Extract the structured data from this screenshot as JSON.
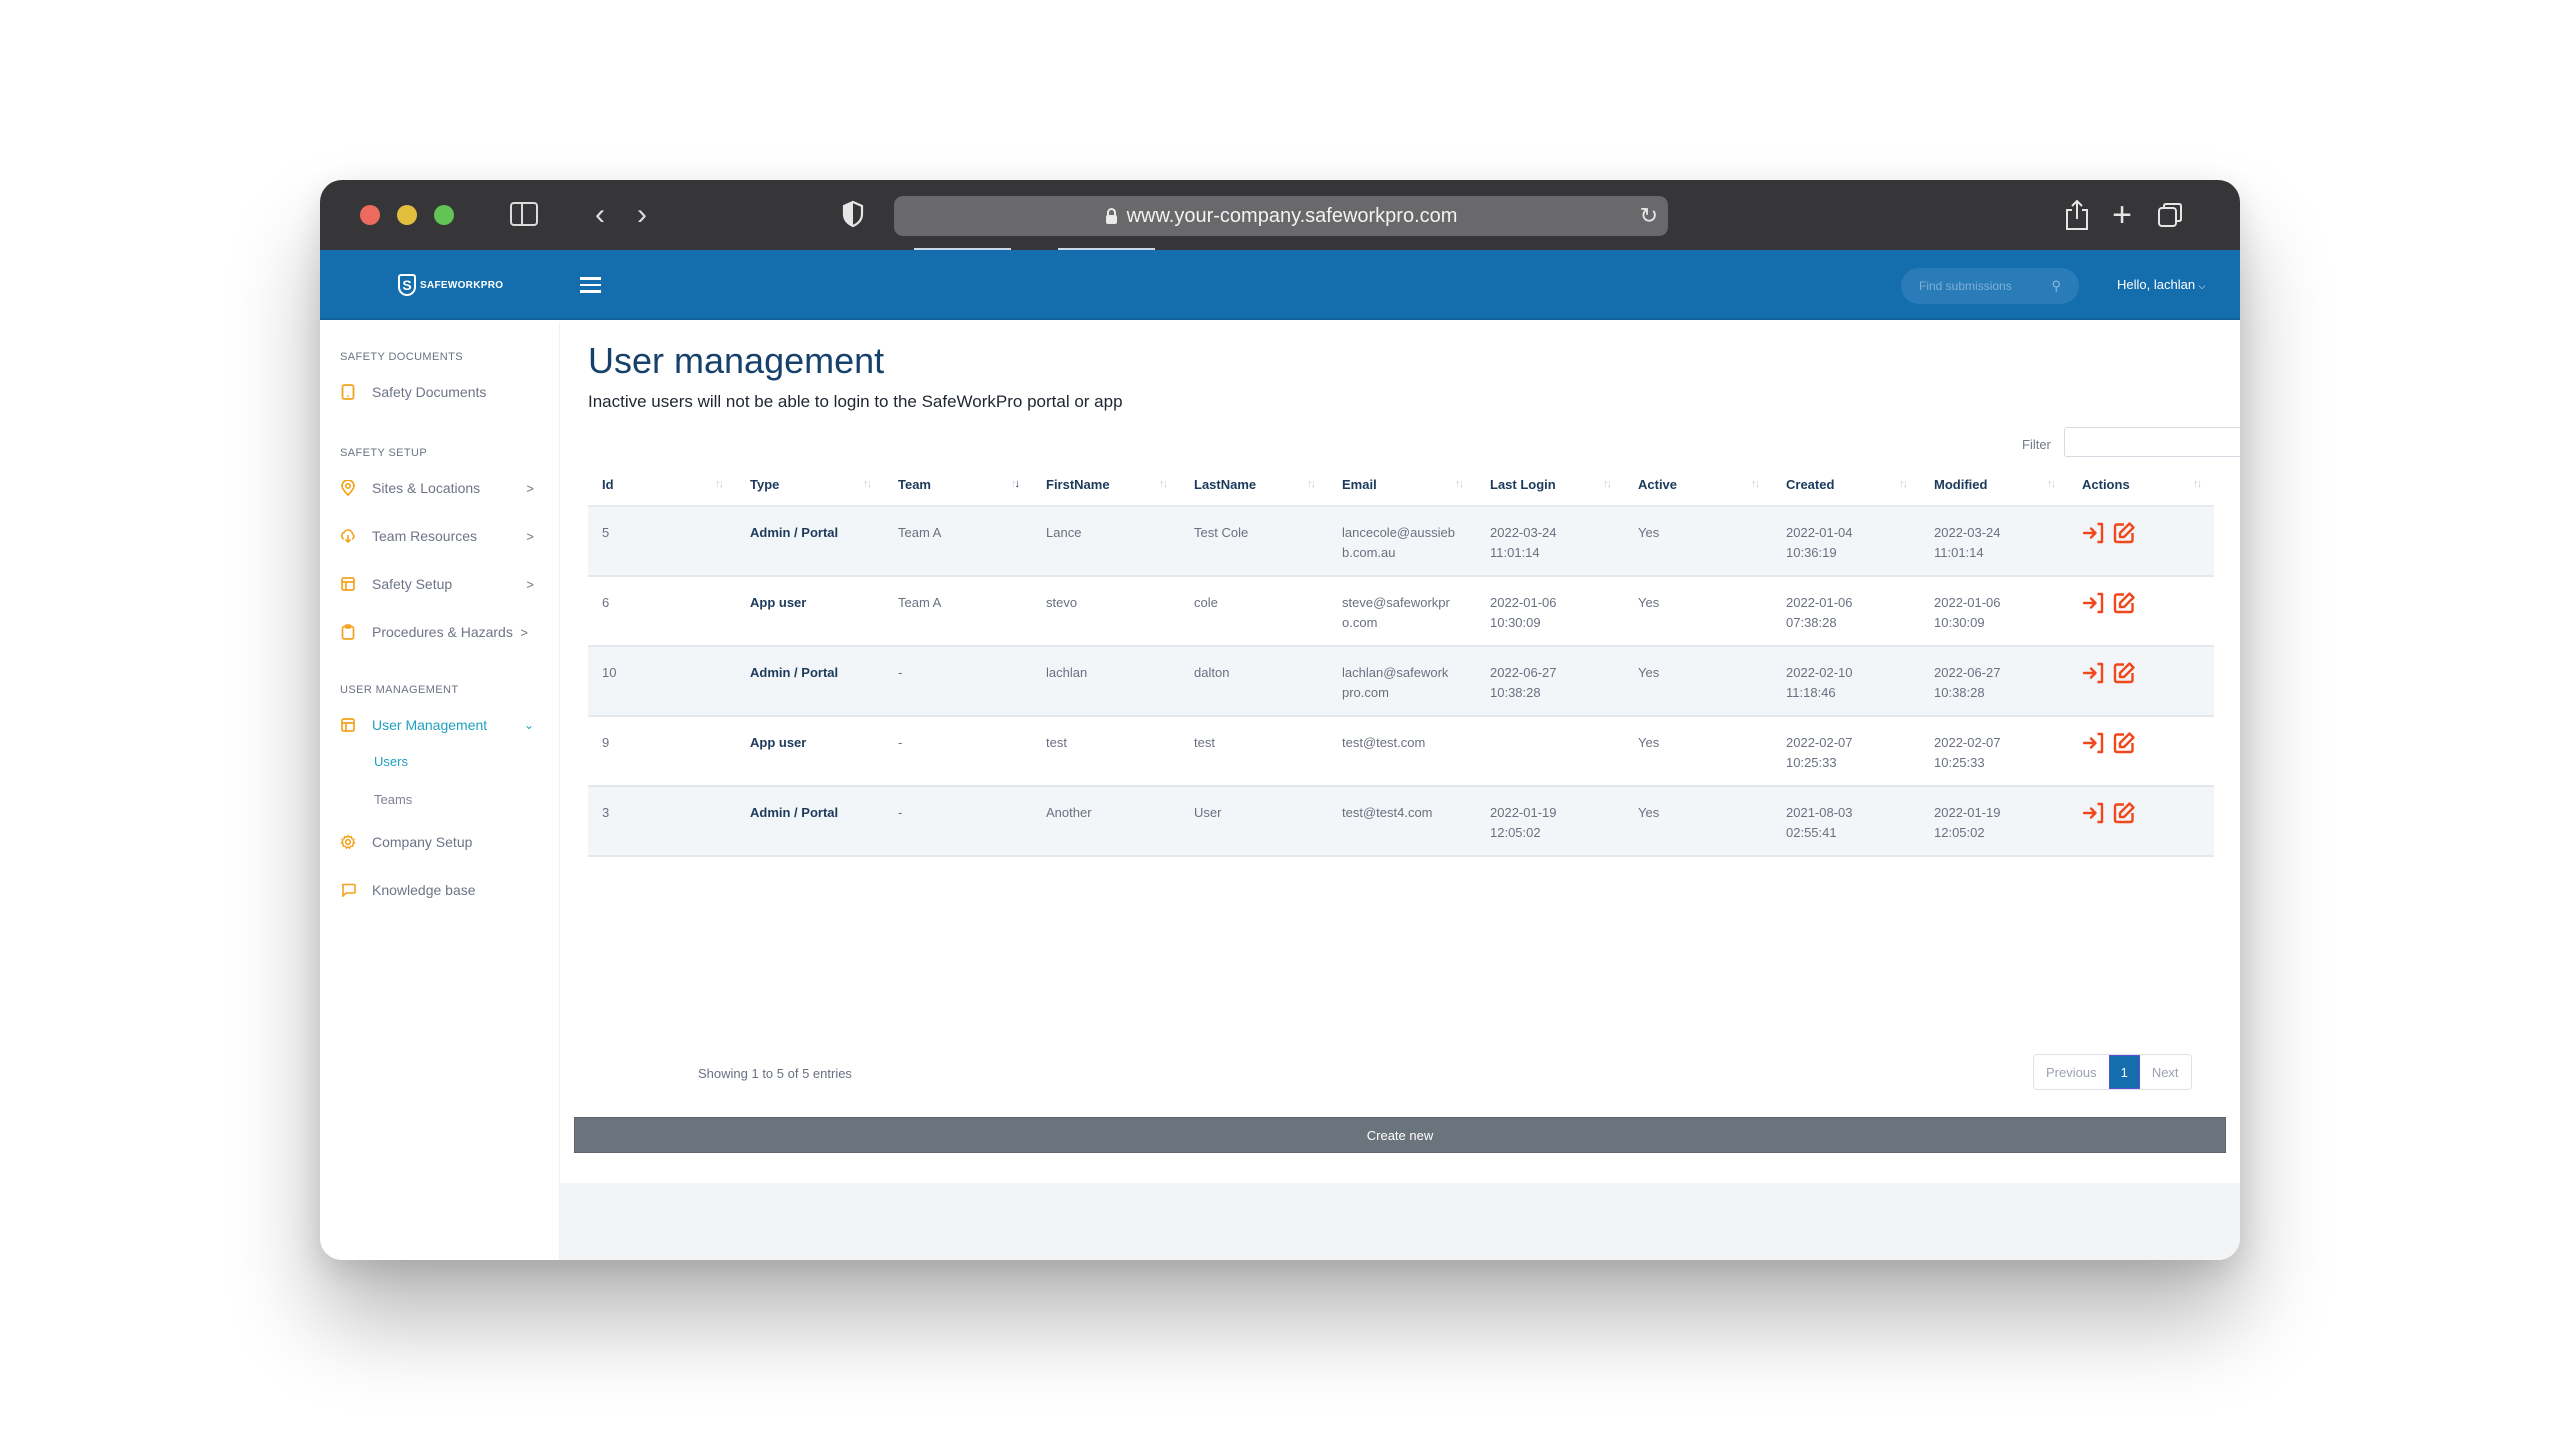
{
  "browser": {
    "url": "www.your-company.safeworkpro.com"
  },
  "header": {
    "logo_text": "SAFEWORKPRO",
    "search_placeholder": "Find submissions",
    "user_greeting": "Hello, lachlan",
    "colors": {
      "brand_blue": "#146eae",
      "accent_orange": "#f4a31d",
      "active_teal": "#1fa0c0",
      "action_red": "#f0471d"
    }
  },
  "sidebar": {
    "sections": [
      {
        "label": "SAFETY DOCUMENTS"
      },
      {
        "label": "SAFETY SETUP"
      },
      {
        "label": "USER MANAGEMENT"
      }
    ],
    "items": [
      {
        "label": "Safety Documents",
        "icon": "tablet-icon"
      },
      {
        "label": "Sites & Locations",
        "icon": "location-pin-icon",
        "chevron": ">"
      },
      {
        "label": "Team Resources",
        "icon": "cloud-download-icon",
        "chevron": ">"
      },
      {
        "label": "Safety Setup",
        "icon": "layout-icon",
        "chevron": ">"
      },
      {
        "label": "Procedures & Hazards",
        "icon": "clipboard-icon",
        "chevron": ">"
      },
      {
        "label": "User Management",
        "icon": "layout-icon",
        "chevron": "⌄",
        "active": true
      },
      {
        "label": "Company Setup",
        "icon": "gear-icon"
      },
      {
        "label": "Knowledge base",
        "icon": "message-icon"
      }
    ],
    "subitems": [
      {
        "label": "Users",
        "active": true
      },
      {
        "label": "Teams"
      }
    ]
  },
  "main": {
    "title": "User management",
    "subtitle": "Inactive users will not be able to login to the SafeWorkPro portal or app",
    "filter_label": "Filter",
    "filter_value": "",
    "table": {
      "columns": [
        "Id",
        "Type",
        "Team",
        "FirstName",
        "LastName",
        "Email",
        "Last Login",
        "Active",
        "Created",
        "Modified",
        "Actions"
      ],
      "sorted_column": "Team",
      "sort_direction": "descending",
      "rows": [
        {
          "id": "5",
          "type": "Admin / Portal",
          "team": "Team A",
          "first": "Lance",
          "last": "Test Cole",
          "email": "lancecole@aussieb b.com.au",
          "last_login": "2022-03-24 11:01:14",
          "active": "Yes",
          "created": "2022-01-04 10:36:19",
          "modified": "2022-03-24 11:01:14"
        },
        {
          "id": "6",
          "type": "App user",
          "team": "Team A",
          "first": "stevo",
          "last": "cole",
          "email": "steve@safeworkpr o.com",
          "last_login": "2022-01-06 10:30:09",
          "active": "Yes",
          "created": "2022-01-06 07:38:28",
          "modified": "2022-01-06 10:30:09"
        },
        {
          "id": "10",
          "type": "Admin / Portal",
          "team": "-",
          "first": "lachlan",
          "last": "dalton",
          "email": "lachlan@safework pro.com",
          "last_login": "2022-06-27 10:38:28",
          "active": "Yes",
          "created": "2022-02-10 11:18:46",
          "modified": "2022-06-27 10:38:28"
        },
        {
          "id": "9",
          "type": "App user",
          "team": "-",
          "first": "test",
          "last": "test",
          "email": "test@test.com",
          "last_login": "",
          "active": "Yes",
          "created": "2022-02-07 10:25:33",
          "modified": "2022-02-07 10:25:33"
        },
        {
          "id": "3",
          "type": "Admin / Portal",
          "team": "-",
          "first": "Another",
          "last": "User",
          "email": "test@test4.com",
          "last_login": "2022-01-19 12:05:02",
          "active": "Yes",
          "created": "2021-08-03 02:55:41",
          "modified": "2022-01-19 12:05:02"
        }
      ],
      "row_actions": [
        "login-as-icon",
        "edit-icon"
      ]
    },
    "showing": "Showing 1 to 5 of 5 entries",
    "pagination": {
      "previous": "Previous",
      "current": "1",
      "next": "Next"
    },
    "create_label": "Create new"
  }
}
